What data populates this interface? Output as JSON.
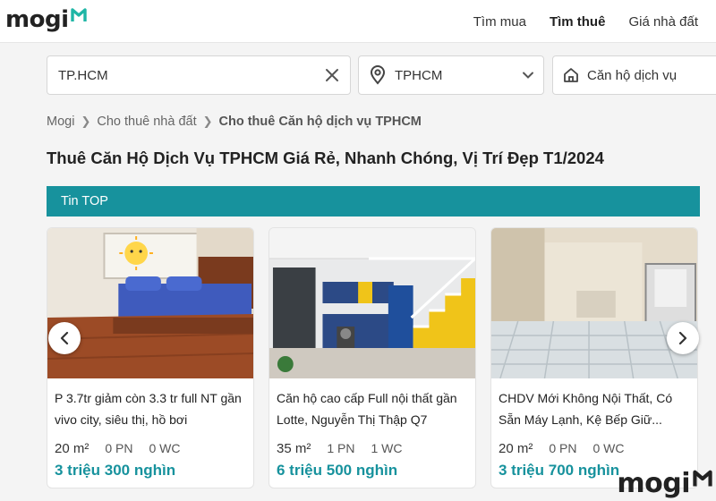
{
  "header": {
    "logo": "mogi",
    "nav": [
      "Tìm mua",
      "Tìm thuê",
      "Giá nhà đất"
    ]
  },
  "search": {
    "keyword_value": "TP.HCM",
    "location": "TPHCM",
    "property_type": "Căn hộ dịch vụ"
  },
  "breadcrumb": [
    "Mogi",
    "Cho thuê nhà đất",
    "Cho thuê Căn hộ dịch vụ TPHCM"
  ],
  "page_title": "Thuê Căn Hộ Dịch Vụ TPHCM Giá Rẻ, Nhanh Chóng, Vị Trí Đẹp T1/2024",
  "section_label": "Tin TOP",
  "listings": [
    {
      "title": "P 3.7tr giảm còn 3.3 tr full NT gần vivo city, siêu thị, hồ bơi",
      "area": "20 m²",
      "bedrooms": "0 PN",
      "bathrooms": "0 WC",
      "price": "3 triệu 300 nghìn"
    },
    {
      "title": "Căn hộ cao cấp Full nội thất gần Lotte, Nguyễn Thị Thập Q7",
      "area": "35 m²",
      "bedrooms": "1 PN",
      "bathrooms": "1 WC",
      "price": "6 triệu 500 nghìn"
    },
    {
      "title": "CHDV Mới Không Nội Thất, Có Sẵn Máy Lạnh, Kệ Bếp Giữ...",
      "area": "20 m²",
      "bedrooms": "0 PN",
      "bathrooms": "0 WC",
      "price": "3 triệu 700 nghìn"
    }
  ],
  "watermark": "mogi",
  "colors": {
    "accent": "#17929d",
    "logo_mark": "#1fb6a6"
  }
}
